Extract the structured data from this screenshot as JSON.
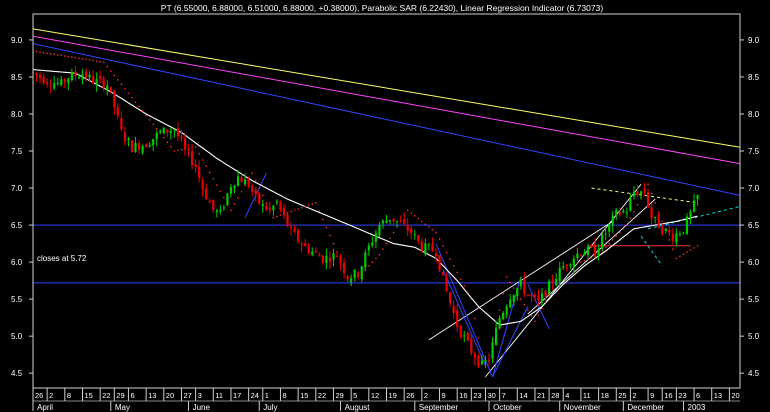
{
  "chart_data": {
    "type": "line",
    "title": "PT (6.55000, 6.88000, 6.51000, 6.88000, +0.38000), Parabolic SAR (6.22430), Linear Regression Indicator (6.73073)",
    "left_note": "closes at 5.72",
    "ylim": [
      4.3,
      9.35
    ],
    "yticks": [
      4.5,
      5.0,
      5.5,
      6.0,
      6.5,
      7.0,
      7.5,
      8.0,
      8.5,
      9.0
    ],
    "ytick_labels": [
      "4.5",
      "5.0",
      "5.5",
      "6.0",
      "6.5",
      "7.0",
      "7.5",
      "8.0",
      "8.5",
      "9.0"
    ],
    "x_range": [
      0,
      200
    ],
    "day_ticks": [
      {
        "x": 0,
        "label": "26"
      },
      {
        "x": 4,
        "label": "2"
      },
      {
        "x": 9,
        "label": "8"
      },
      {
        "x": 14,
        "label": "15"
      },
      {
        "x": 19,
        "label": "22"
      },
      {
        "x": 23,
        "label": "29"
      },
      {
        "x": 27,
        "label": "6"
      },
      {
        "x": 32,
        "label": "13"
      },
      {
        "x": 37,
        "label": "20"
      },
      {
        "x": 42,
        "label": "27"
      },
      {
        "x": 46,
        "label": "3"
      },
      {
        "x": 51,
        "label": "11"
      },
      {
        "x": 56,
        "label": "17"
      },
      {
        "x": 61,
        "label": "24"
      },
      {
        "x": 65,
        "label": "1"
      },
      {
        "x": 70,
        "label": "8"
      },
      {
        "x": 75,
        "label": "15"
      },
      {
        "x": 80,
        "label": "22"
      },
      {
        "x": 85,
        "label": "29"
      },
      {
        "x": 90,
        "label": "5"
      },
      {
        "x": 95,
        "label": "12"
      },
      {
        "x": 100,
        "label": "19"
      },
      {
        "x": 105,
        "label": "26"
      },
      {
        "x": 110,
        "label": "2"
      },
      {
        "x": 115,
        "label": "9"
      },
      {
        "x": 120,
        "label": "16"
      },
      {
        "x": 124,
        "label": "23"
      },
      {
        "x": 128,
        "label": "30"
      },
      {
        "x": 132,
        "label": "7"
      },
      {
        "x": 137,
        "label": "14"
      },
      {
        "x": 142,
        "label": "21"
      },
      {
        "x": 146,
        "label": "28"
      },
      {
        "x": 150,
        "label": "4"
      },
      {
        "x": 155,
        "label": "11"
      },
      {
        "x": 160,
        "label": "18"
      },
      {
        "x": 165,
        "label": "25"
      },
      {
        "x": 169,
        "label": "2"
      },
      {
        "x": 174,
        "label": "9"
      },
      {
        "x": 178,
        "label": "16"
      },
      {
        "x": 182,
        "label": "23"
      },
      {
        "x": 187,
        "label": "6"
      },
      {
        "x": 192,
        "label": "13"
      },
      {
        "x": 197,
        "label": "20"
      }
    ],
    "months": [
      {
        "x": 2,
        "label": "April"
      },
      {
        "x": 24,
        "label": "May"
      },
      {
        "x": 46,
        "label": "June"
      },
      {
        "x": 66,
        "label": "July"
      },
      {
        "x": 89,
        "label": "August"
      },
      {
        "x": 110,
        "label": "September"
      },
      {
        "x": 131,
        "label": "October"
      },
      {
        "x": 151,
        "label": "November"
      },
      {
        "x": 169,
        "label": "December"
      },
      {
        "x": 186,
        "label": "2003"
      }
    ],
    "series": [
      {
        "kind": "price",
        "color_up": "#00cc00",
        "color_down": "#ee0000",
        "anchors": [
          [
            0,
            8.55
          ],
          [
            4,
            8.45
          ],
          [
            8,
            8.4
          ],
          [
            10,
            8.5
          ],
          [
            14,
            8.55
          ],
          [
            17,
            8.45
          ],
          [
            21,
            8.4
          ],
          [
            23,
            8.1
          ],
          [
            25,
            7.75
          ],
          [
            28,
            7.55
          ],
          [
            32,
            7.6
          ],
          [
            36,
            7.75
          ],
          [
            40,
            7.8
          ],
          [
            43,
            7.5
          ],
          [
            46,
            7.3
          ],
          [
            48,
            7.0
          ],
          [
            51,
            6.7
          ],
          [
            53,
            6.65
          ],
          [
            56,
            7.05
          ],
          [
            58,
            7.15
          ],
          [
            61,
            7.05
          ],
          [
            63,
            6.85
          ],
          [
            65,
            6.75
          ],
          [
            67,
            6.7
          ],
          [
            69,
            6.8
          ],
          [
            73,
            6.4
          ],
          [
            77,
            6.2
          ],
          [
            82,
            6.05
          ],
          [
            86,
            6.1
          ],
          [
            89,
            5.8
          ],
          [
            92,
            5.85
          ],
          [
            95,
            6.2
          ],
          [
            98,
            6.5
          ],
          [
            101,
            6.6
          ],
          [
            103,
            6.55
          ],
          [
            107,
            6.4
          ],
          [
            110,
            6.2
          ],
          [
            114,
            6.15
          ],
          [
            116,
            5.75
          ],
          [
            120,
            5.15
          ],
          [
            124,
            4.8
          ],
          [
            127,
            4.6
          ],
          [
            129,
            4.7
          ],
          [
            132,
            5.25
          ],
          [
            135,
            5.55
          ],
          [
            138,
            5.7
          ],
          [
            140,
            5.55
          ],
          [
            143,
            5.45
          ],
          [
            147,
            5.75
          ],
          [
            151,
            6.0
          ],
          [
            155,
            6.15
          ],
          [
            159,
            6.15
          ],
          [
            162,
            6.4
          ],
          [
            165,
            6.65
          ],
          [
            168,
            6.7
          ],
          [
            170,
            6.95
          ],
          [
            173,
            6.95
          ],
          [
            175,
            6.6
          ],
          [
            178,
            6.45
          ],
          [
            181,
            6.35
          ],
          [
            184,
            6.45
          ],
          [
            186,
            6.65
          ],
          [
            188,
            6.88
          ]
        ]
      },
      {
        "kind": "moving-average",
        "color": "#ffffff",
        "anchors": [
          [
            0,
            8.6
          ],
          [
            12,
            8.55
          ],
          [
            22,
            8.3
          ],
          [
            32,
            8.0
          ],
          [
            42,
            7.75
          ],
          [
            52,
            7.4
          ],
          [
            62,
            7.1
          ],
          [
            72,
            6.85
          ],
          [
            82,
            6.65
          ],
          [
            92,
            6.45
          ],
          [
            102,
            6.25
          ],
          [
            108,
            6.2
          ],
          [
            114,
            6.05
          ],
          [
            120,
            5.75
          ],
          [
            126,
            5.4
          ],
          [
            132,
            5.15
          ],
          [
            138,
            5.2
          ],
          [
            144,
            5.4
          ],
          [
            150,
            5.7
          ],
          [
            156,
            5.95
          ],
          [
            162,
            6.15
          ],
          [
            166,
            6.3
          ],
          [
            170,
            6.45
          ],
          [
            176,
            6.5
          ],
          [
            182,
            6.55
          ],
          [
            188,
            6.62
          ]
        ]
      },
      {
        "kind": "parabolic-sar",
        "color": "#ff3030",
        "anchors": [
          [
            0,
            8.85
          ],
          [
            20,
            8.7
          ],
          [
            30,
            8.1
          ],
          [
            40,
            7.5
          ],
          [
            46,
            7.55
          ],
          [
            56,
            6.7
          ],
          [
            62,
            7.2
          ],
          [
            68,
            6.6
          ],
          [
            80,
            6.8
          ],
          [
            90,
            5.7
          ],
          [
            98,
            6.1
          ],
          [
            106,
            6.7
          ],
          [
            114,
            6.4
          ],
          [
            124,
            5.5
          ],
          [
            128,
            4.45
          ],
          [
            134,
            5.8
          ],
          [
            142,
            5.2
          ],
          [
            150,
            5.9
          ],
          [
            160,
            6.1
          ],
          [
            168,
            6.5
          ],
          [
            174,
            7.05
          ],
          [
            182,
            6.05
          ],
          [
            188,
            6.22
          ]
        ]
      }
    ],
    "lines": [
      {
        "kind": "trendline",
        "color": "#ffff66",
        "from": [
          0,
          9.15
        ],
        "to": [
          200,
          7.55
        ]
      },
      {
        "kind": "trendline",
        "color": "#ff44ff",
        "from": [
          0,
          9.05
        ],
        "to": [
          200,
          7.33
        ]
      },
      {
        "kind": "trendline",
        "color": "#3344ff",
        "from": [
          0,
          8.95
        ],
        "to": [
          200,
          6.9
        ]
      },
      {
        "kind": "support",
        "color": "#3344ff",
        "from": [
          0,
          6.5
        ],
        "to": [
          200,
          6.5
        ]
      },
      {
        "kind": "support",
        "color": "#3344ff",
        "from": [
          0,
          5.72
        ],
        "to": [
          200,
          5.72
        ]
      },
      {
        "kind": "channel",
        "color": "#ffffff",
        "from": [
          112,
          4.95
        ],
        "to": [
          164,
          6.55
        ]
      },
      {
        "kind": "channel",
        "color": "#ffffff",
        "from": [
          128,
          4.45
        ],
        "to": [
          172,
          7.05
        ]
      },
      {
        "kind": "channel",
        "color": "#ffffff",
        "from": [
          140,
          5.3
        ],
        "to": [
          176,
          6.85
        ]
      },
      {
        "kind": "fan",
        "color": "#3344ff",
        "from": [
          114,
          6.25
        ],
        "to": [
          130,
          4.45
        ]
      },
      {
        "kind": "fan",
        "color": "#3344ff",
        "from": [
          116,
          5.9
        ],
        "to": [
          128,
          4.6
        ]
      },
      {
        "kind": "fan",
        "color": "#3344ff",
        "from": [
          130,
          4.45
        ],
        "to": [
          140,
          5.4
        ]
      },
      {
        "kind": "fan",
        "color": "#3344ff",
        "from": [
          130,
          4.45
        ],
        "to": [
          138,
          5.8
        ]
      },
      {
        "kind": "fan",
        "color": "#3344ff",
        "from": [
          60,
          6.6
        ],
        "to": [
          66,
          7.2
        ]
      },
      {
        "kind": "fan",
        "color": "#3344ff",
        "from": [
          140,
          5.7
        ],
        "to": [
          146,
          5.1
        ]
      },
      {
        "kind": "dashed",
        "color": "#ffff66",
        "from": [
          158,
          7.0
        ],
        "to": [
          188,
          6.8
        ]
      },
      {
        "kind": "dashed",
        "color": "#00dddd",
        "from": [
          174,
          6.45
        ],
        "to": [
          200,
          6.75
        ]
      },
      {
        "kind": "dashed",
        "color": "#00dddd",
        "from": [
          172,
          6.35
        ],
        "to": [
          178,
          5.95
        ]
      },
      {
        "kind": "red-level",
        "color": "#ff3030",
        "from": [
          157,
          6.22
        ],
        "to": [
          186,
          6.22
        ]
      }
    ]
  }
}
